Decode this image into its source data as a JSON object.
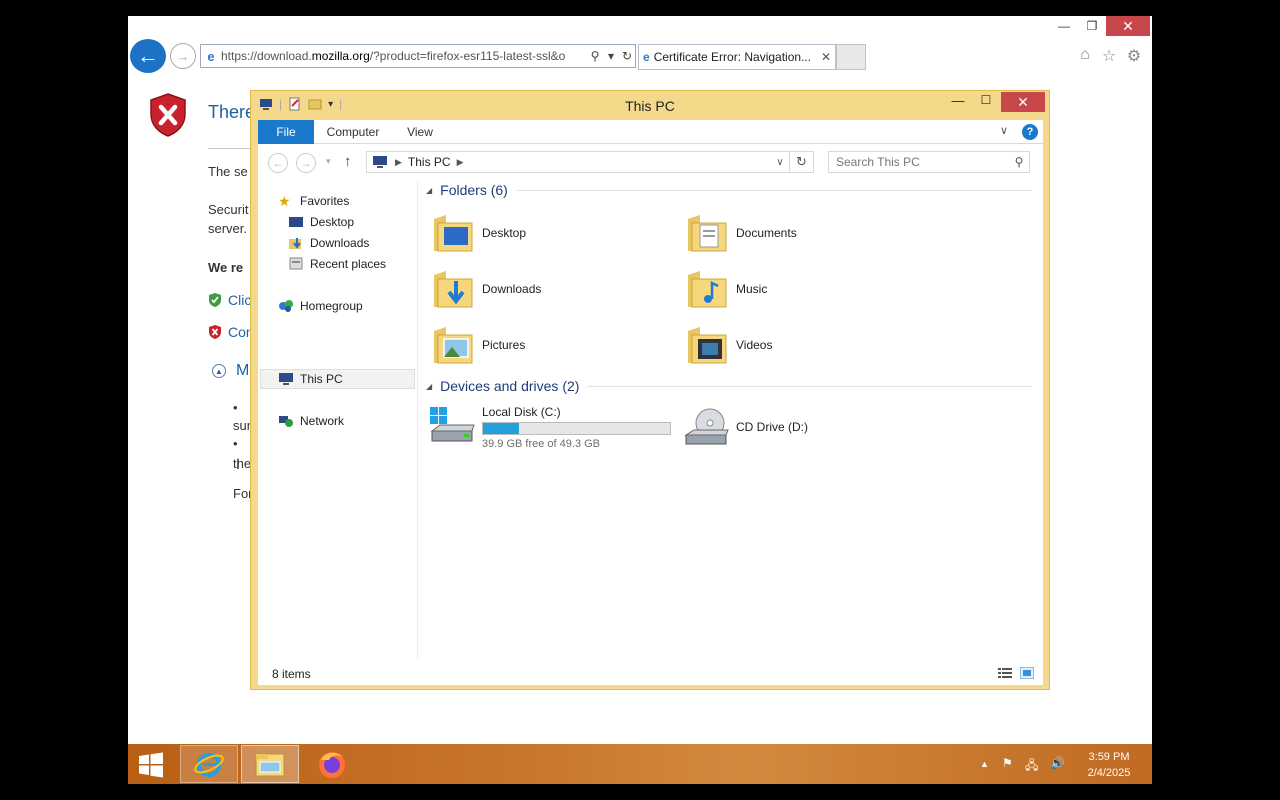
{
  "ie": {
    "url_prefix": "https://download.",
    "url_domain": "mozilla.org",
    "url_suffix": "/?product=firefox-esr115-latest-ssl&o",
    "tab_title": "Certificate Error: Navigation...",
    "tab_close": "✕"
  },
  "cert_page": {
    "title_visible": "There",
    "line1": "The se",
    "line2a": "Securit",
    "line2b": "server.",
    "recommend": "We re",
    "link_click": "Clic",
    "link_continue": "Con",
    "more_info": "M",
    "bullet1a": "•",
    "bullet1b": "sur",
    "bullet2a": "•",
    "bullet2b": "the",
    "footer": "For"
  },
  "explorer": {
    "title": "This PC",
    "ribbon_tabs": [
      "File",
      "Computer",
      "View"
    ],
    "breadcrumb": "This PC",
    "search_placeholder": "Search This PC",
    "nav": {
      "favorites": "Favorites",
      "desktop": "Desktop",
      "downloads": "Downloads",
      "recent": "Recent places",
      "homegroup": "Homegroup",
      "thispc": "This PC",
      "network": "Network"
    },
    "folders_header": "Folders (6)",
    "folders": [
      {
        "name": "Desktop",
        "icon": "desktop-folder-icon"
      },
      {
        "name": "Documents",
        "icon": "documents-folder-icon"
      },
      {
        "name": "Downloads",
        "icon": "downloads-folder-icon"
      },
      {
        "name": "Music",
        "icon": "music-folder-icon"
      },
      {
        "name": "Pictures",
        "icon": "pictures-folder-icon"
      },
      {
        "name": "Videos",
        "icon": "videos-folder-icon"
      }
    ],
    "drives_header": "Devices and drives (2)",
    "drives": [
      {
        "name": "Local Disk (C:)",
        "free_text": "39.9 GB free of 49.3 GB",
        "used_fraction": 0.19
      },
      {
        "name": "CD Drive (D:)"
      }
    ],
    "status": "8 items"
  },
  "taskbar": {
    "time": "3:59 PM",
    "date": "2/4/2025"
  },
  "colors": {
    "explorer_frame": "#f5d98a",
    "file_tab": "#1979ca",
    "drive_fill": "#26a0da",
    "close_button": "#c7474b",
    "taskbar": "#c8772c"
  }
}
